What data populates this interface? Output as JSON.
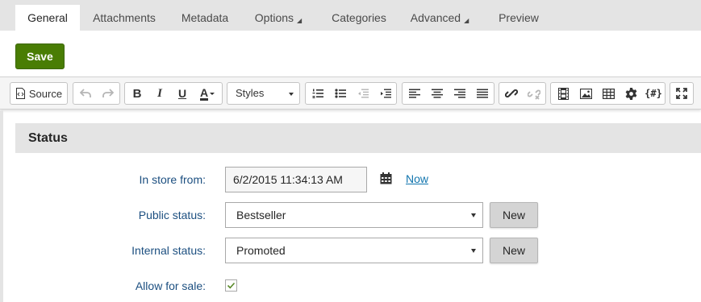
{
  "tabs": [
    {
      "label": "General",
      "active": true
    },
    {
      "label": "Attachments"
    },
    {
      "label": "Metadata"
    },
    {
      "label": "Options"
    },
    {
      "label": "Categories"
    },
    {
      "label": "Advanced"
    },
    {
      "label": "Preview"
    }
  ],
  "save_label": "Save",
  "toolbar": {
    "source_label": "Source",
    "styles_label": "Styles",
    "bold": "B",
    "italic": "I",
    "underline": "U",
    "text_color": "A",
    "code_label": "{#}"
  },
  "section": {
    "title": "Status"
  },
  "form": {
    "in_store_label": "In store from:",
    "in_store_value": "6/2/2015 11:34:13 AM",
    "now_label": "Now",
    "public_status_label": "Public status:",
    "public_status_value": "Bestseller",
    "internal_status_label": "Internal status:",
    "internal_status_value": "Promoted",
    "new_label": "New",
    "allow_sale_label": "Allow for sale:",
    "allow_sale_checked": true
  },
  "colors": {
    "save_button": "#497d04",
    "label_text": "#1c4f80",
    "link": "#1175ae",
    "tab_bar": "#e4e4e4"
  }
}
